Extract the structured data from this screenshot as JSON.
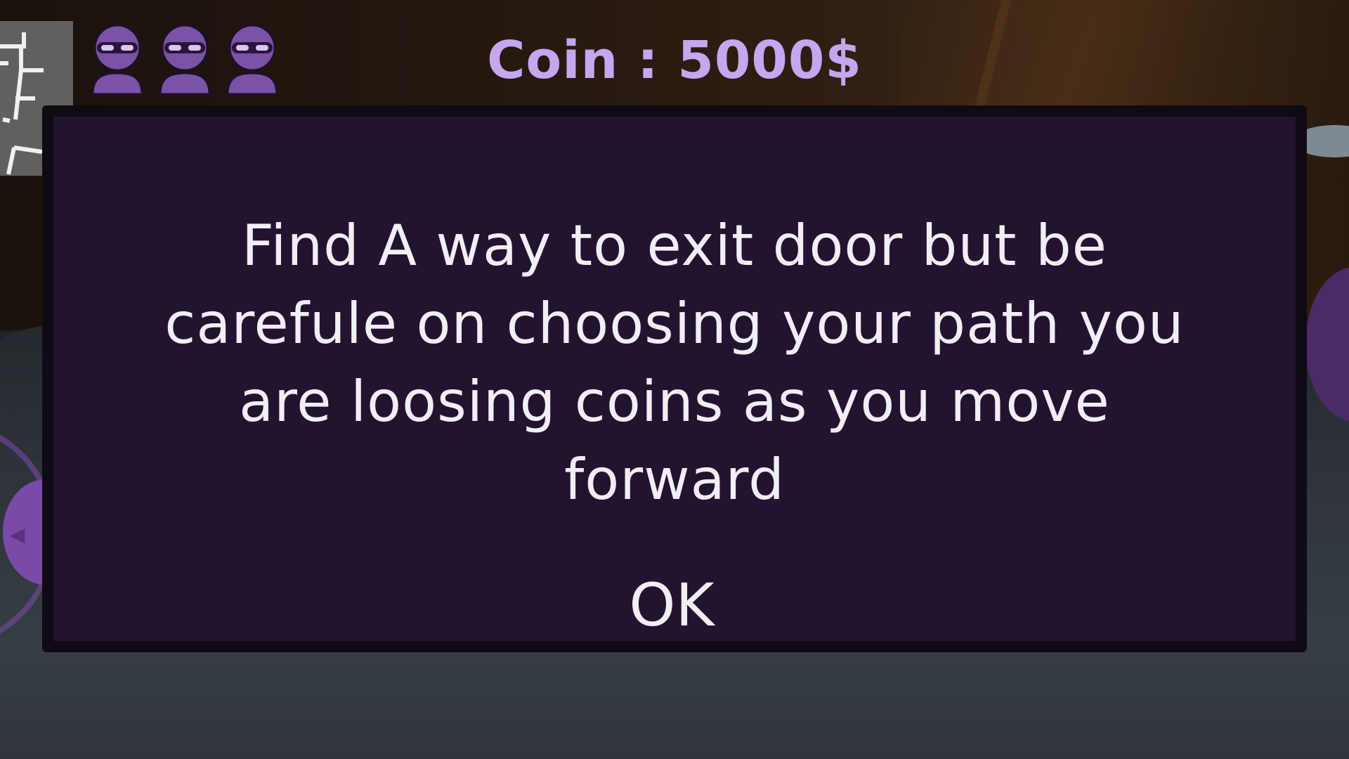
{
  "hud": {
    "coin_label": "Coin : 5000$",
    "lives_icons": [
      "ninja-head-icon",
      "ninja-head-icon",
      "ninja-head-icon"
    ],
    "minimap_icon": "minimap-icon",
    "joystick_icon": "left-arrow-icon"
  },
  "dialog": {
    "message": "Find A way to exit door but be carefule on choosing your path you are loosing coins as you move forward",
    "ok_label": "OK"
  },
  "colors": {
    "accent_purple": "#c5a6ef",
    "dialog_bg": "#221430",
    "dialog_border": "#0f0a14",
    "text": "#f2eef5"
  }
}
